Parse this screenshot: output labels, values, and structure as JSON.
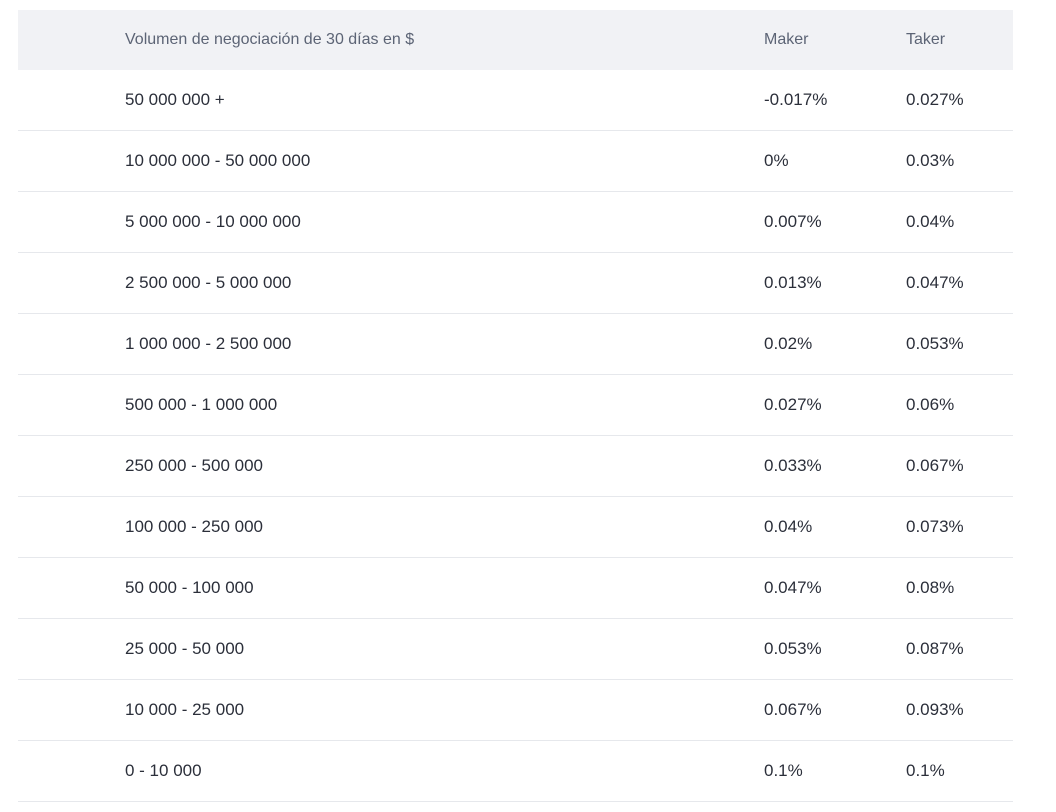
{
  "table": {
    "headers": {
      "volume": "Volumen de negociación de 30 días en $",
      "maker": "Maker",
      "taker": "Taker"
    },
    "rows": [
      {
        "volume": "50 000 000 +",
        "maker": "-0.017%",
        "taker": "0.027%"
      },
      {
        "volume": "10 000 000 - 50 000 000",
        "maker": "0%",
        "taker": "0.03%"
      },
      {
        "volume": "5 000 000 - 10 000 000",
        "maker": "0.007%",
        "taker": "0.04%"
      },
      {
        "volume": "2 500 000 - 5 000 000",
        "maker": "0.013%",
        "taker": "0.047%"
      },
      {
        "volume": "1 000 000 - 2 500 000",
        "maker": "0.02%",
        "taker": "0.053%"
      },
      {
        "volume": "500 000 - 1 000 000",
        "maker": "0.027%",
        "taker": "0.06%"
      },
      {
        "volume": "250 000 - 500 000",
        "maker": "0.033%",
        "taker": "0.067%"
      },
      {
        "volume": "100 000 - 250 000",
        "maker": "0.04%",
        "taker": "0.073%"
      },
      {
        "volume": "50 000 - 100 000",
        "maker": "0.047%",
        "taker": "0.08%"
      },
      {
        "volume": "25 000 - 50 000",
        "maker": "0.053%",
        "taker": "0.087%"
      },
      {
        "volume": "10 000 - 25 000",
        "maker": "0.067%",
        "taker": "0.093%"
      },
      {
        "volume": "0 - 10 000",
        "maker": "0.1%",
        "taker": "0.1%"
      }
    ]
  }
}
